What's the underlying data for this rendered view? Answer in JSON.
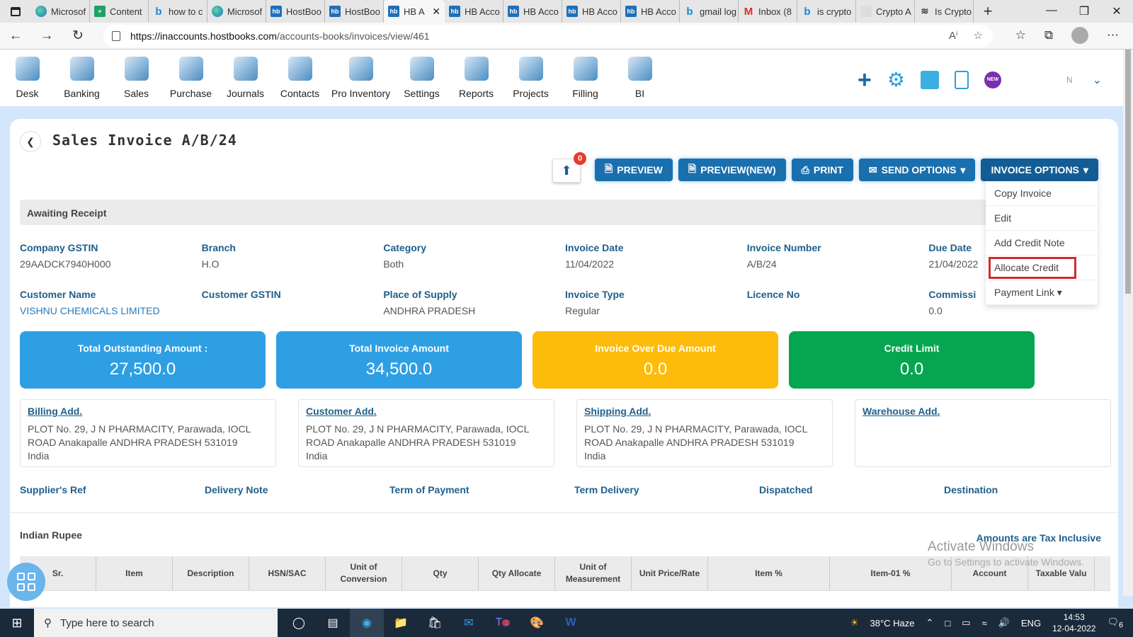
{
  "browser": {
    "tabs": [
      {
        "icon": "edge",
        "label": "Microsof"
      },
      {
        "icon": "sheets",
        "label": "Content"
      },
      {
        "icon": "bing",
        "label": "how to c"
      },
      {
        "icon": "edge",
        "label": "Microsof"
      },
      {
        "icon": "hb",
        "label": "HostBoo"
      },
      {
        "icon": "hb",
        "label": "HostBoo"
      },
      {
        "icon": "hb",
        "label": "HB A",
        "active": true
      },
      {
        "icon": "hb",
        "label": "HB Acco"
      },
      {
        "icon": "hb",
        "label": "HB Acco"
      },
      {
        "icon": "hb",
        "label": "HB Acco"
      },
      {
        "icon": "hb",
        "label": "HB Acco"
      },
      {
        "icon": "bing",
        "label": "gmail log"
      },
      {
        "icon": "gmail",
        "label": "Inbox (8"
      },
      {
        "icon": "bing",
        "label": "is crypto"
      },
      {
        "icon": "blank",
        "label": "Crypto A"
      },
      {
        "icon": "wave",
        "label": "Is Crypto"
      }
    ],
    "url_host": "https://inaccounts.hostbooks.com",
    "url_path": "/accounts-books/invoices/view/461"
  },
  "topnav": {
    "items": [
      "Desk",
      "Banking",
      "Sales",
      "Purchase",
      "Journals",
      "Contacts",
      "Pro Inventory",
      "Settings",
      "Reports",
      "Projects",
      "Filling",
      "BI"
    ],
    "right_icons": [
      "plus-icon",
      "gear-icon",
      "calculator-icon",
      "document-icon",
      "new-badge-icon"
    ],
    "user_initial": "N"
  },
  "page": {
    "title": "Sales Invoice A/B/24",
    "upload_badge": "0",
    "buttons": {
      "preview": "PREVIEW",
      "preview_new": "PREVIEW(NEW)",
      "print": "PRINT",
      "send_options": "SEND OPTIONS",
      "invoice_options": "INVOICE OPTIONS"
    },
    "invoice_options_menu": [
      "Copy Invoice",
      "Edit",
      "Add Credit Note",
      "Allocate Credit",
      "Payment Link"
    ],
    "highlighted_menu_item": "Allocate Credit",
    "status": "Awaiting Receipt",
    "fields_row1": [
      {
        "label": "Company GSTIN",
        "value": "29AADCK7940H000"
      },
      {
        "label": "Branch",
        "value": "H.O"
      },
      {
        "label": "Category",
        "value": "Both"
      },
      {
        "label": "Invoice Date",
        "value": "11/04/2022"
      },
      {
        "label": "Invoice Number",
        "value": "A/B/24"
      },
      {
        "label": "Due Date",
        "value": "21/04/2022"
      }
    ],
    "fields_row2": [
      {
        "label": "Customer Name",
        "value": "VISHNU CHEMICALS LIMITED"
      },
      {
        "label": "Customer GSTIN",
        "value": ""
      },
      {
        "label": "Place of Supply",
        "value": "ANDHRA PRADESH"
      },
      {
        "label": "Invoice Type",
        "value": "Regular"
      },
      {
        "label": "Licence No",
        "value": ""
      },
      {
        "label": "Commissi",
        "value": "0.0"
      }
    ],
    "kpis": [
      {
        "label": "Total Outstanding Amount :",
        "value": "27,500.0",
        "color": "#2f9fe3"
      },
      {
        "label": "Total Invoice Amount",
        "value": "34,500.0",
        "color": "#2f9fe3"
      },
      {
        "label": "Invoice Over Due Amount",
        "value": "0.0",
        "color": "#fdbb0b"
      },
      {
        "label": "Credit Limit",
        "value": "0.0",
        "color": "#06a54f"
      }
    ],
    "addresses": [
      {
        "label": "Billing Add.",
        "lines": [
          "PLOT No. 29, J N PHARMACITY, Parawada, IOCL",
          "ROAD Anakapalle ANDHRA PRADESH 531019",
          "India"
        ]
      },
      {
        "label": "Customer Add.",
        "lines": [
          "PLOT No. 29, J N PHARMACITY, Parawada, IOCL",
          "ROAD Anakapalle ANDHRA PRADESH 531019",
          "India"
        ]
      },
      {
        "label": "Shipping Add.",
        "lines": [
          "PLOT No. 29, J N PHARMACITY, Parawada, IOCL",
          "ROAD Anakapalle ANDHRA PRADESH 531019",
          "India"
        ]
      },
      {
        "label": "Warehouse Add.",
        "lines": []
      }
    ],
    "refs": [
      "Supplier's Ref",
      "Delivery Note",
      "Term of Payment",
      "Term Delivery",
      "Dispatched",
      "Destination"
    ],
    "currency": "Indian Rupee",
    "tax_note": "Amounts are Tax Inclusive",
    "table_headers": [
      "Sr.",
      "Item",
      "Description",
      "HSN/SAC",
      "Unit of Conversion",
      "Qty",
      "Qty Allocate",
      "Unit of Measurement",
      "Unit Price/Rate",
      "Item %",
      "Item-01 %",
      "Account",
      "Taxable Valu"
    ]
  },
  "watermark": {
    "line1": "Activate Windows",
    "line2": "Go to Settings to activate Windows."
  },
  "taskbar": {
    "search_placeholder": "Type here to search",
    "weather": "38°C  Haze",
    "lang": "ENG",
    "time": "14:53",
    "date": "12-04-2022",
    "notifications": "6",
    "teams_badge": "1"
  }
}
